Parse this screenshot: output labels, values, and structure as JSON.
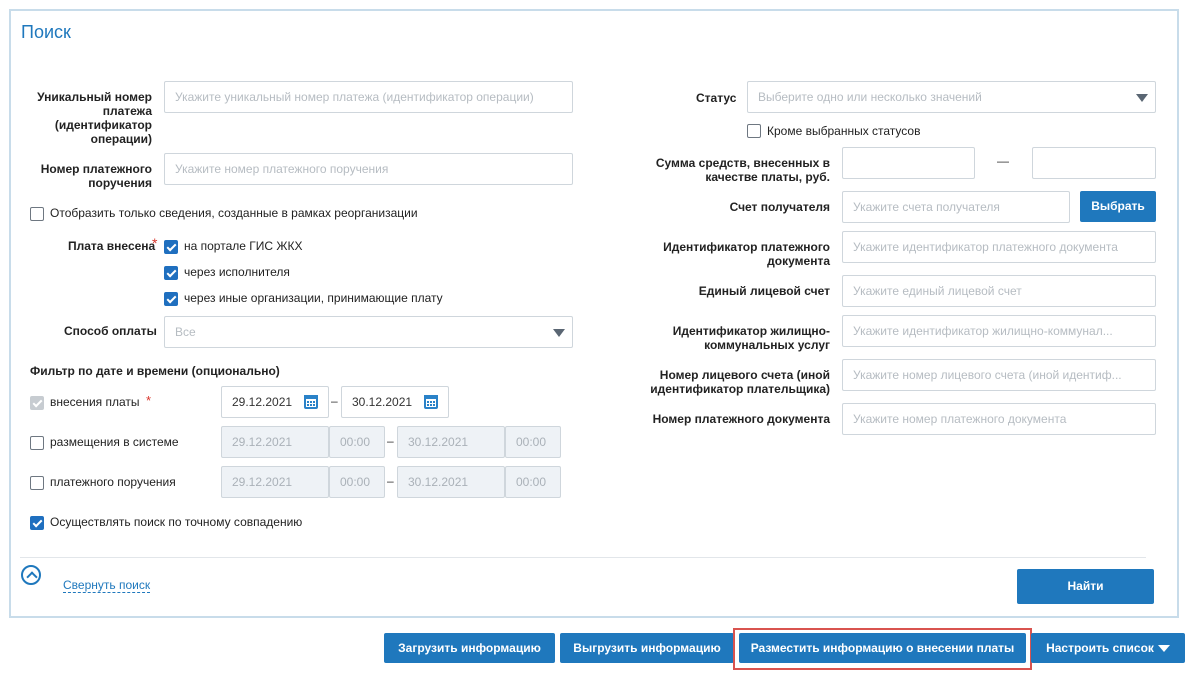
{
  "search": {
    "title": "Поиск",
    "left": {
      "unique_number_label": "Уникальный номер платежа (идентификатор операции)",
      "unique_number_placeholder": "Укажите уникальный номер платежа (идентификатор операции)",
      "order_number_label": "Номер платежного поручения",
      "order_number_placeholder": "Укажите номер платежного поручения",
      "reorg_label": "Отобразить только сведения, созданные в рамках реорганизации",
      "paid_via_label": "Плата внесена",
      "required_mark": "*",
      "paid_via_options": [
        {
          "label": "на портале ГИС ЖКХ",
          "checked": true
        },
        {
          "label": "через исполнителя",
          "checked": true
        },
        {
          "label": "через иные организации, принимающие плату",
          "checked": true
        }
      ],
      "payment_method_label": "Способ оплаты",
      "payment_method_value": "Все",
      "date_filter_heading": "Фильтр по дате и времени (опционально)",
      "payment_date_label": "внесения платы",
      "payment_date_from": "29.12.2021",
      "payment_date_to": "30.12.2021",
      "placement_label": "размещения в системе",
      "placement_date_from": "29.12.2021",
      "placement_time_from": "00:00",
      "placement_date_to": "30.12.2021",
      "placement_time_to": "00:00",
      "order_date_label": "платежного поручения",
      "order_date_from": "29.12.2021",
      "order_time_from": "00:00",
      "order_date_to": "30.12.2021",
      "order_time_to": "00:00",
      "exact_match_label": "Осуществлять поиск по точному совпадению",
      "dash": "–"
    },
    "right": {
      "status_label": "Статус",
      "status_placeholder": "Выберите одно или несколько значений",
      "except_statuses_label": "Кроме выбранных статусов",
      "amount_label": "Сумма средств, внесенных в качестве платы, руб.",
      "amount_from": "",
      "amount_to": "",
      "amount_dash": "—",
      "account_label": "Счет получателя",
      "account_placeholder": "Укажите счета получателя",
      "select_button": "Выбрать",
      "doc_id_label": "Идентификатор платежного документа",
      "doc_id_placeholder": "Укажите идентификатор платежного документа",
      "single_account_label": "Единый лицевой счет",
      "single_account_placeholder": "Укажите единый лицевой счет",
      "housing_id_label": "Идентификатор жилищно-коммунальных услуг",
      "housing_id_placeholder": "Укажите идентификатор жилищно-коммунал...",
      "personal_account_label": "Номер лицевого счета (иной идентификатор плательщика)",
      "personal_account_placeholder": "Укажите номер лицевого счета (иной идентиф...",
      "payment_doc_number_label": "Номер платежного документа",
      "payment_doc_number_placeholder": "Укажите номер платежного документа"
    },
    "collapse_label": "Свернуть поиск",
    "find_button": "Найти"
  },
  "toolbar": {
    "upload": "Загрузить информацию",
    "download": "Выгрузить информацию",
    "place": "Разместить информацию о внесении платы",
    "configure": "Настроить список"
  },
  "colors": {
    "accent": "#1f78bd",
    "highlight": "#d9534f"
  }
}
